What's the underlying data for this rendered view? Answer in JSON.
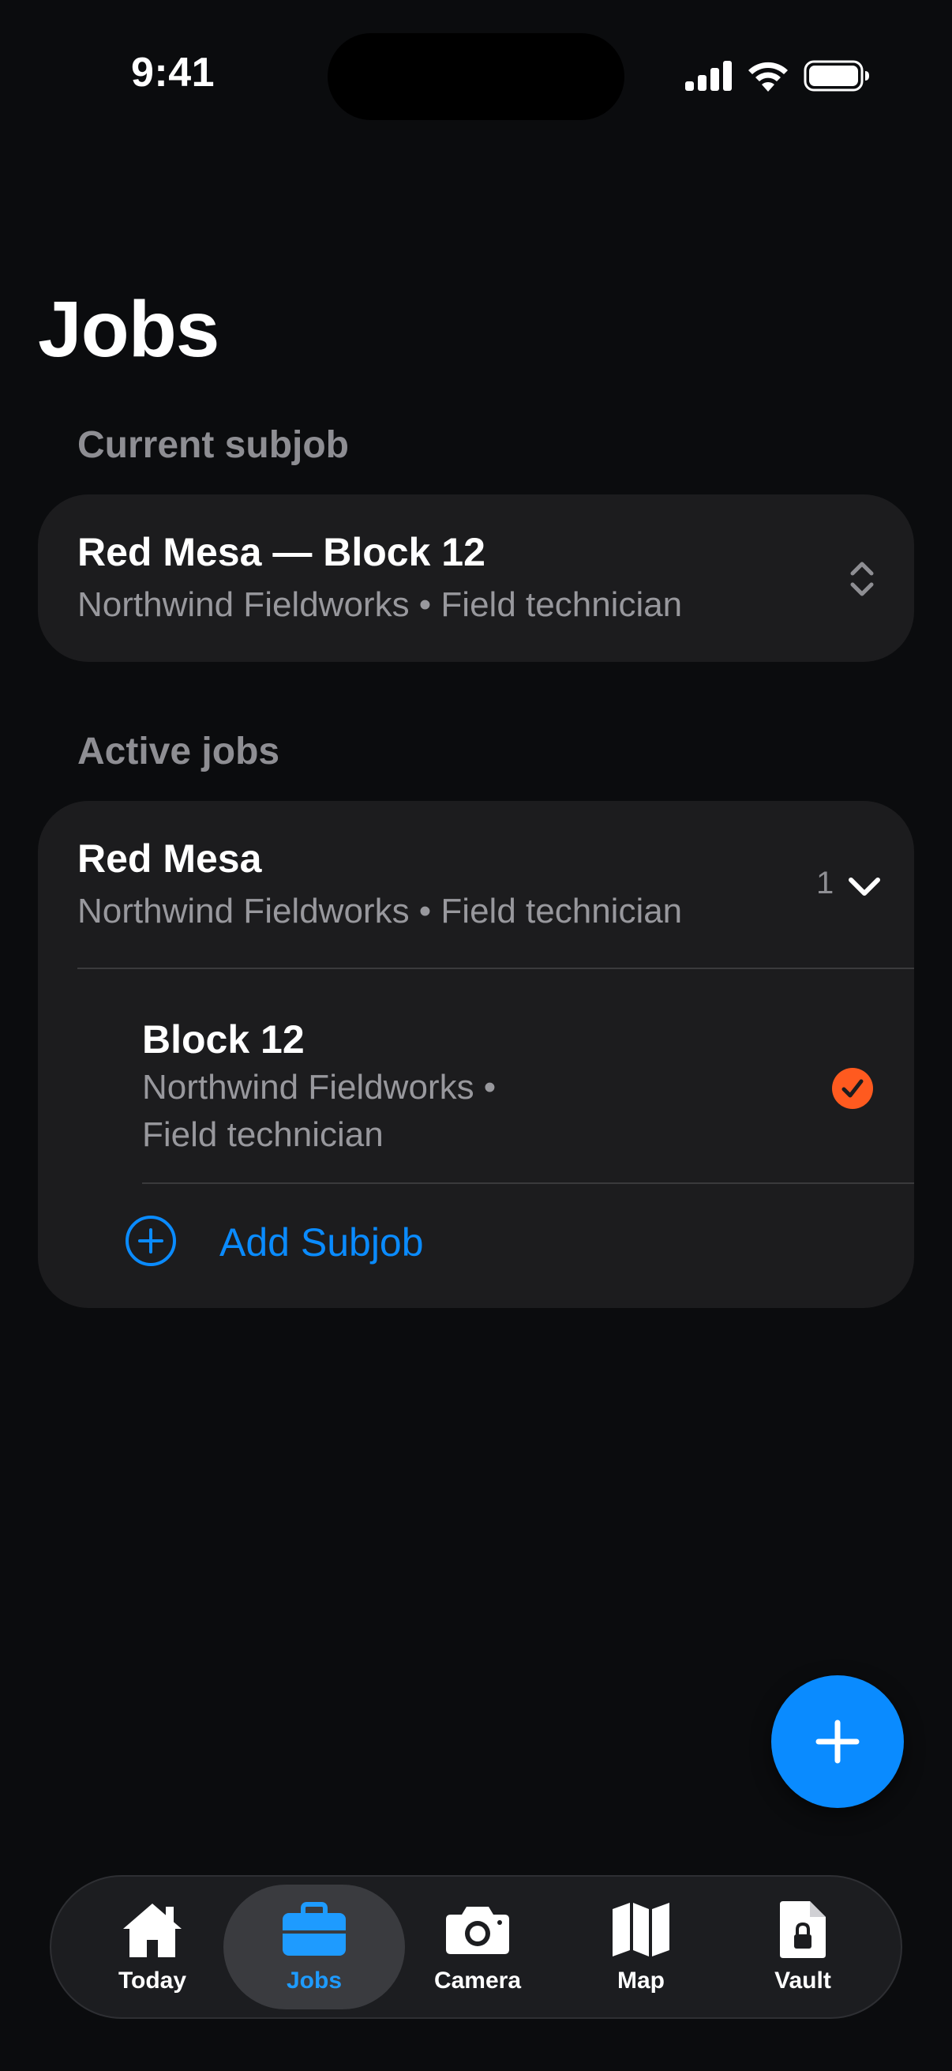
{
  "status_bar": {
    "time": "9:41"
  },
  "page": {
    "title": "Jobs"
  },
  "current_subjob": {
    "section_label": "Current subjob",
    "title": "Red Mesa — Block 12",
    "subtitle": "Northwind Fieldworks • Field technician"
  },
  "active_jobs": {
    "section_label": "Active jobs",
    "job": {
      "title": "Red Mesa",
      "subtitle": "Northwind Fieldworks • Field technician",
      "subjob_count": "1"
    },
    "subjob": {
      "title": "Block 12",
      "subtitle_line1": "Northwind Fieldworks •",
      "subtitle_line2": "Field technician"
    },
    "add_subjob_label": "Add Subjob"
  },
  "tabs": [
    {
      "label": "Today",
      "icon": "house-icon"
    },
    {
      "label": "Jobs",
      "icon": "briefcase-icon",
      "active": true
    },
    {
      "label": "Camera",
      "icon": "camera-icon"
    },
    {
      "label": "Map",
      "icon": "map-icon"
    },
    {
      "label": "Vault",
      "icon": "locked-document-icon"
    }
  ],
  "colors": {
    "accent": "#0a8bff",
    "selected_check": "#ff5a1f",
    "background": "#0b0c0e",
    "card": "#1c1c1e"
  }
}
